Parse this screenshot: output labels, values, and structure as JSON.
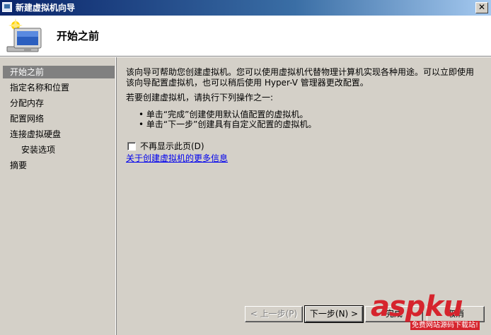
{
  "window": {
    "title": "新建虚拟机向导",
    "close_label": "✕"
  },
  "header": {
    "title": "开始之前",
    "icon": "computer-wizard-icon"
  },
  "nav": {
    "items": [
      {
        "label": "开始之前",
        "active": true
      },
      {
        "label": "指定名称和位置"
      },
      {
        "label": "分配内存"
      },
      {
        "label": "配置网络"
      },
      {
        "label": "连接虚拟硬盘"
      },
      {
        "label": "安装选项",
        "sub": true
      },
      {
        "label": "摘要"
      }
    ]
  },
  "content": {
    "para1": "该向导可帮助您创建虚拟机。您可以使用虚拟机代替物理计算机实现各种用途。可以立即使用该向导配置虚拟机，也可以稍后使用 Hyper-V 管理器更改配置。",
    "para2": "若要创建虚拟机，请执行下列操作之一:",
    "bullet1": "• 单击“完成”创建使用默认值配置的虚拟机。",
    "bullet2": "• 单击“下一步”创建具有自定义配置的虚拟机。",
    "checkbox_label": "不再显示此页(D)",
    "checkbox_checked": false,
    "link": "关于创建虚拟机的更多信息"
  },
  "buttons": {
    "prev": "< 上一步(P)",
    "next": "下一步(N) >",
    "finish": "完成",
    "cancel": "取消"
  },
  "watermark": {
    "text": "aspku",
    "sub": "免费网站源码下载站!"
  },
  "colors": {
    "titlebar_start": "#0a246a",
    "titlebar_end": "#a6caf0",
    "dialog_bg": "#d4d0c8",
    "nav_selected": "#808080",
    "link": "#0000ee",
    "watermark": "#d6242d"
  }
}
